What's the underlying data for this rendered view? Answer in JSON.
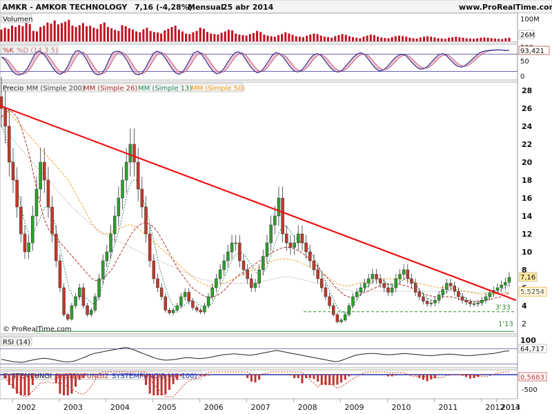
{
  "header": {
    "ticker_name": "AMKR - AMKOR TECHNOLOGY",
    "last_change": "7,16 (-4,28%)",
    "period": "Mensual",
    "date": "25 abr 2014",
    "site": "www.ProRealTime.com"
  },
  "copyright": "© ProRealTime.com",
  "colors": {
    "bull": "#2ca02c",
    "bear": "#c0392b",
    "trendline": "#ee1111",
    "ma200": "#888888",
    "ma26": "#b03030",
    "ma13": "#2a8a5a",
    "ma50": "#f0a020",
    "panel_bg": "#ffffff",
    "axis_bg": "#ffffff",
    "volume": "#c01020",
    "stoch_k": "#333399",
    "stoch_fill": "#e8a0b0",
    "rsi": "#222222"
  },
  "chart_data": [
    {
      "type": "bar",
      "panel": "volume",
      "label": "Volumen",
      "y_ticks": [
        "100M",
        "26M"
      ],
      "ylim": [
        0,
        100
      ],
      "values": [
        45,
        52,
        48,
        60,
        55,
        62,
        58,
        70,
        66,
        40,
        38,
        55,
        60,
        72,
        68,
        80,
        65,
        70,
        75,
        82,
        60,
        55,
        62,
        70,
        58,
        60,
        52,
        48,
        66,
        72,
        55,
        50,
        44,
        40,
        62,
        58,
        50,
        45,
        38,
        35,
        46,
        52,
        40,
        36,
        34,
        30,
        42,
        48,
        55,
        60,
        45,
        38,
        30,
        28,
        35,
        40,
        52,
        48,
        36,
        30,
        28,
        26,
        33,
        38,
        45,
        42,
        30,
        26,
        24,
        22,
        28,
        32,
        40,
        36,
        26,
        22,
        20,
        18,
        24,
        28,
        35,
        30,
        25,
        20,
        18,
        16,
        22,
        26,
        30,
        28,
        22,
        18,
        16,
        14,
        20,
        24,
        28,
        25,
        20,
        16,
        14,
        12,
        18,
        22,
        26,
        24,
        18,
        15,
        13,
        12,
        16,
        20,
        22,
        20,
        18,
        14,
        12,
        11,
        15,
        18,
        20,
        18,
        15,
        12,
        11,
        10,
        14,
        16,
        18,
        16,
        14,
        12,
        11,
        10,
        12,
        14,
        15,
        14,
        12,
        11,
        10,
        9,
        12,
        14
      ],
      "last_value": "26M"
    },
    {
      "type": "line",
      "panel": "stochastic",
      "series": [
        {
          "name": "%K"
        },
        {
          "name": "%D (14 3 5)"
        }
      ],
      "y_ticks": [
        "100",
        "50",
        "0"
      ],
      "ylim": [
        0,
        100
      ],
      "k_values": [
        70,
        60,
        40,
        20,
        10,
        8,
        15,
        30,
        55,
        80,
        90,
        85,
        70,
        50,
        30,
        15,
        10,
        20,
        40,
        70,
        90,
        92,
        80,
        60,
        35,
        15,
        8,
        12,
        30,
        60,
        85,
        90,
        88,
        75,
        55,
        30,
        12,
        8,
        15,
        35,
        60,
        82,
        90,
        85,
        70,
        50,
        30,
        15,
        10,
        20,
        40,
        65,
        85,
        90,
        80,
        60,
        40,
        22,
        12,
        15,
        30,
        50,
        70,
        85,
        88,
        80,
        60,
        40,
        25,
        15,
        20,
        35,
        55,
        75,
        85,
        82,
        70,
        52,
        35,
        22,
        18,
        25,
        40,
        60,
        75,
        82,
        78,
        62,
        45,
        30,
        20,
        18,
        25,
        40,
        55,
        70,
        80,
        85,
        78,
        62,
        45,
        30,
        22,
        25,
        35,
        50,
        65,
        75,
        80,
        76,
        62,
        48,
        35,
        28,
        30,
        38,
        52,
        66,
        78,
        82,
        75,
        62,
        48,
        38,
        35,
        40,
        50,
        62,
        74,
        84,
        90,
        92,
        93,
        94,
        95,
        94,
        92,
        93
      ],
      "last_value": "93,421"
    },
    {
      "type": "candlestick",
      "panel": "price",
      "series": [
        {
          "name": "Precio"
        },
        {
          "name": "MM (Simple 200)"
        },
        {
          "name": "MM (Simple 26)"
        },
        {
          "name": "MM (Simple 13)"
        },
        {
          "name": "MM (Simple 50)"
        }
      ],
      "x_ticks": [
        "2002",
        "2003",
        "2004",
        "2005",
        "2006",
        "2007",
        "2008",
        "2009",
        "2010",
        "2011",
        "2012",
        "2013",
        "2014"
      ],
      "y_ticks": [
        "28",
        "26",
        "24",
        "22",
        "20",
        "18",
        "16",
        "14",
        "12",
        "10",
        "8",
        "6",
        "4",
        "2"
      ],
      "ylim": [
        0,
        29
      ],
      "annotations": [
        "3'33",
        "1'13"
      ],
      "levels": [
        3.33,
        1.13
      ],
      "trendline": [
        [
          "2001-10",
          26.3
        ],
        [
          "2014-04",
          4.6
        ]
      ],
      "last_price": "7,16",
      "ma_value": "5,5254",
      "closes": [
        26,
        24,
        20,
        18,
        15,
        12,
        10,
        11,
        14,
        17,
        20,
        18,
        15,
        12,
        9,
        6,
        3,
        2.5,
        4,
        5,
        6,
        4,
        3,
        3.5,
        5,
        7,
        9,
        10,
        12,
        14,
        16,
        18,
        20,
        22,
        20,
        17,
        15,
        12,
        9,
        7,
        6,
        5,
        3.5,
        3.2,
        3.5,
        4,
        5,
        5.5,
        4.5,
        3.8,
        3.5,
        3.3,
        4,
        5,
        6,
        7,
        8,
        9,
        10,
        11,
        11,
        9,
        8,
        7,
        6,
        6.5,
        8,
        9.5,
        11,
        13,
        14,
        16,
        12,
        11,
        10.5,
        11,
        12,
        11,
        10,
        9,
        8,
        7,
        6,
        5,
        4,
        3,
        2.2,
        2.4,
        3,
        4,
        5,
        5.5,
        6,
        6.5,
        7,
        7.5,
        7,
        6.5,
        6,
        5.5,
        6,
        7,
        7.5,
        8,
        7,
        6.5,
        5.5,
        5,
        4.5,
        4.2,
        4.3,
        4.6,
        5.2,
        5.8,
        6.5,
        6.2,
        5.6,
        5,
        4.6,
        4.4,
        4.2,
        4.2,
        4.3,
        4.6,
        5,
        5.4,
        5.7,
        6,
        6.3,
        6.6,
        7.16
      ],
      "ma200": [
        24,
        23.5,
        23,
        22.5,
        22,
        21.5,
        21,
        20.5,
        20,
        19.5,
        19,
        18.5,
        18,
        17.5,
        17,
        16.5,
        16,
        15.5,
        15,
        14.6,
        14.2,
        13.8,
        13.4,
        13,
        12.7,
        12.4,
        12.1,
        11.8,
        11.5,
        11.3,
        11.1,
        10.9,
        10.7,
        10.5,
        10.3,
        10.1,
        9.9,
        9.7,
        9.5,
        9.3,
        9.1,
        8.9,
        8.7,
        8.5,
        8.3,
        8.1,
        7.9,
        7.7,
        7.5,
        7.3,
        7.1,
        7,
        6.9,
        6.8,
        6.7,
        6.6,
        6.5,
        6.5,
        6.5,
        6.5,
        6.5,
        6.5,
        6.5,
        6.5,
        6.5,
        6.5,
        6.6,
        6.7,
        6.8,
        6.9,
        7,
        7.1,
        7.2,
        7.2,
        7.2,
        7.1,
        7,
        6.9,
        6.8,
        6.7,
        6.6,
        6.5,
        6.4,
        6.3,
        6.2,
        6.1,
        6,
        5.9,
        5.8,
        5.7,
        5.6,
        5.6,
        5.6,
        5.6,
        5.6,
        5.6,
        5.6,
        5.6,
        5.6,
        5.6,
        5.6,
        5.6,
        5.6,
        5.6,
        5.6,
        5.6,
        5.6,
        5.6,
        5.6,
        5.6,
        5.6,
        5.6,
        5.6,
        5.6,
        5.6,
        5.6,
        5.6,
        5.6,
        5.6,
        5.6,
        5.6,
        5.5,
        5.5,
        5.5,
        5.5,
        5.5,
        5.5,
        5.5,
        5.5,
        5.5,
        5.5
      ],
      "ma26": [
        25,
        25.5,
        25.8,
        25.5,
        25,
        24,
        22.5,
        21,
        19,
        17,
        15,
        13.5,
        12.5,
        12,
        11.5,
        11,
        10.5,
        10,
        9.5,
        9,
        8.5,
        8,
        7.5,
        7,
        6.8,
        6.8,
        7,
        7.5,
        8,
        8.8,
        9.6,
        10.4,
        11.2,
        12,
        12.6,
        13,
        13.2,
        13.2,
        13,
        12.6,
        12,
        11.2,
        10.4,
        9.6,
        8.8,
        8,
        7.4,
        6.8,
        6.2,
        5.8,
        5.5,
        5.2,
        5,
        4.9,
        5,
        5.2,
        5.5,
        5.9,
        6.4,
        6.9,
        7.3,
        7.6,
        7.9,
        8.2,
        8.5,
        8.8,
        9.1,
        9.4,
        9.7,
        10,
        10.2,
        10.4,
        10.5,
        10.5,
        10.4,
        10.2,
        10,
        9.7,
        9.3,
        8.9,
        8.5,
        8,
        7.5,
        7,
        6.5,
        6,
        5.6,
        5.2,
        5,
        4.9,
        5,
        5.2,
        5.4,
        5.6,
        5.8,
        6,
        6.2,
        6.3,
        6.4,
        6.4,
        6.4,
        6.4,
        6.3,
        6.2,
        6,
        5.8,
        5.6,
        5.4,
        5.2,
        5.1,
        5,
        5,
        5,
        5,
        5,
        4.9,
        4.8,
        4.7,
        4.6,
        4.5,
        4.5,
        4.5,
        4.5,
        4.6,
        4.7,
        4.8,
        4.9,
        5,
        5.2,
        5.4
      ],
      "ma13": [
        24,
        23,
        21,
        19,
        17,
        15,
        13,
        12,
        12,
        13,
        14,
        15,
        15,
        14,
        12,
        10,
        8,
        6,
        5,
        4.8,
        5,
        5,
        4.6,
        4.2,
        4.5,
        5.5,
        7,
        8.5,
        10,
        11.5,
        13,
        15,
        17,
        18,
        18,
        17,
        15.5,
        14,
        12,
        10,
        8,
        6.5,
        5.2,
        4.2,
        3.8,
        3.8,
        4,
        4.4,
        4.6,
        4.4,
        4,
        3.8,
        3.8,
        4.2,
        5,
        6,
        7,
        8,
        9,
        9.6,
        10,
        9.8,
        9.2,
        8.5,
        7.8,
        7.4,
        7.6,
        8.4,
        9.6,
        11,
        12.2,
        13,
        12.8,
        12.2,
        11.6,
        11.2,
        11,
        10.6,
        10,
        9.2,
        8.4,
        7.4,
        6.4,
        5.4,
        4.4,
        3.6,
        3.2,
        3.2,
        3.6,
        4.2,
        4.9,
        5.5,
        6,
        6.4,
        6.8,
        7,
        6.9,
        6.6,
        6.3,
        6.2,
        6.4,
        6.8,
        7.1,
        7,
        6.6,
        6,
        5.4,
        5,
        4.7,
        4.5,
        4.6,
        5,
        5.5,
        5.8,
        5.9,
        5.6,
        5.2,
        4.8,
        4.5,
        4.3,
        4.3,
        4.4,
        4.6,
        4.9,
        5.2,
        5.5,
        5.8,
        6.1,
        6.4
      ],
      "ma50": [
        26,
        25.8,
        25.5,
        25,
        24.5,
        24,
        23.5,
        23,
        22.5,
        22,
        21.5,
        21,
        20.5,
        20,
        19.5,
        19,
        18.5,
        18,
        17.2,
        16.4,
        15.6,
        14.8,
        14,
        13.2,
        12.6,
        12.2,
        12,
        12,
        12.2,
        12.4,
        12.6,
        12.8,
        13,
        13,
        12.8,
        12.5,
        12.2,
        11.8,
        11.4,
        11,
        10.6,
        10.2,
        9.8,
        9.4,
        9,
        8.6,
        8.2,
        7.8,
        7.4,
        7,
        6.7,
        6.5,
        6.3,
        6.2,
        6.2,
        6.3,
        6.4,
        6.6,
        6.8,
        7,
        7.2,
        7.4,
        7.6,
        7.8,
        8,
        8.2,
        8.4,
        8.6,
        8.8,
        9,
        9.1,
        9.2,
        9.2,
        9.2,
        9.1,
        9,
        8.8,
        8.6,
        8.4,
        8.2,
        8,
        7.7,
        7.4,
        7.1,
        6.8,
        6.5,
        6.3,
        6.2,
        6.2,
        6.3,
        6.4,
        6.5,
        6.6,
        6.7,
        6.8,
        6.9,
        7,
        7,
        7,
        7,
        7,
        7,
        6.9,
        6.8,
        6.7,
        6.6,
        6.5,
        6.4,
        6.3,
        6.2,
        6.1,
        6,
        6,
        6,
        6,
        5.9,
        5.8,
        5.7,
        5.6,
        5.5,
        5.4,
        5.3,
        5.3,
        5.3,
        5.3,
        5.3,
        5.3,
        5.3,
        5.4,
        5.5
      ]
    },
    {
      "type": "line",
      "panel": "rsi",
      "series": [
        {
          "name": "RSI (14)"
        }
      ],
      "y_ticks": [
        "100"
      ],
      "ylim": [
        0,
        100
      ],
      "values": [
        42,
        40,
        38,
        36,
        35,
        34,
        35,
        38,
        40,
        42,
        44,
        45,
        44,
        42,
        40,
        38,
        36,
        35,
        36,
        38,
        42,
        46,
        50,
        55,
        58,
        60,
        62,
        64,
        66,
        68,
        70,
        72,
        74,
        72,
        68,
        64,
        60,
        56,
        52,
        48,
        44,
        42,
        40,
        40,
        41,
        42,
        44,
        46,
        47,
        46,
        45,
        44,
        45,
        46,
        48,
        50,
        52,
        54,
        55,
        56,
        57,
        56,
        55,
        54,
        53,
        54,
        56,
        58,
        60,
        62,
        64,
        66,
        64,
        62,
        60,
        58,
        56,
        54,
        52,
        50,
        48,
        46,
        44,
        42,
        40,
        38,
        36,
        37,
        40,
        44,
        48,
        52,
        54,
        56,
        57,
        58,
        58,
        57,
        56,
        55,
        54,
        55,
        56,
        57,
        58,
        57,
        56,
        55,
        54,
        53,
        52,
        52,
        53,
        54,
        55,
        56,
        56,
        55,
        54,
        53,
        52,
        52,
        53,
        54,
        55,
        56,
        57,
        58,
        60,
        62,
        64,
        64.7
      ],
      "last_value": "64,717"
    },
    {
      "type": "bar",
      "panel": "systemfungi",
      "series": [
        {
          "name": "SYSTEMFUNGI"
        },
        {
          "name": "SYSTEMFUNGI2"
        },
        {
          "name": "SYSTEMFUNGI3 (40 100)"
        }
      ],
      "y_ticks": [
        "0",
        "-500"
      ],
      "last_value": "0,5683"
    }
  ]
}
